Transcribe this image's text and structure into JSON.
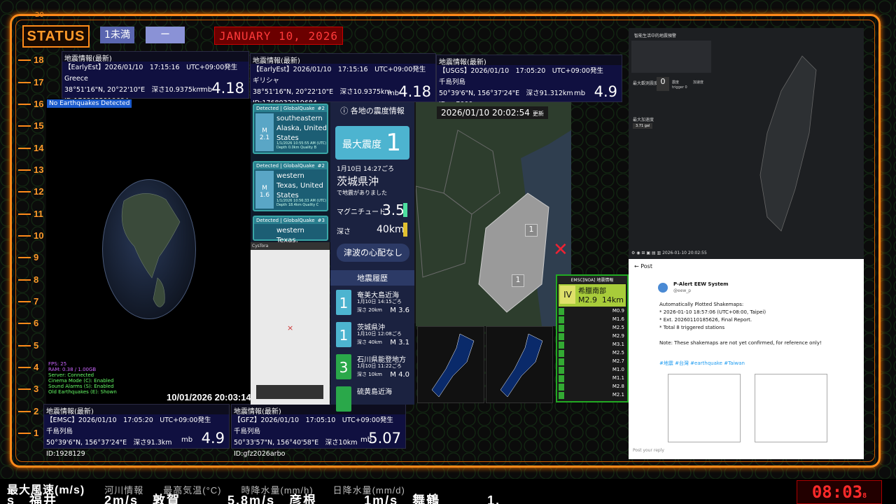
{
  "top_number": "20",
  "status": "STATUS",
  "chip1": "1未満",
  "chip2": "ー",
  "date_banner": "JANUARY 10, 2026",
  "ruler": [
    "18",
    "17",
    "16",
    "15",
    "14",
    "13",
    "12",
    "11",
    "10",
    "9",
    "8",
    "7",
    "6",
    "5",
    "4",
    "3",
    "2",
    "1"
  ],
  "eq_panels": [
    {
      "head": "地震情報(最新)",
      "l1": "【EarlyEst】2026/01/10　17:15:16　UTC+09:00発生",
      "l2": "Greece",
      "l3": "38°51'16\"N, 20°22'10\"E　深さ10.9375km",
      "l4": "ID:1768032919684",
      "mb": "mb",
      "mag": "4.18"
    },
    {
      "head": "地震情報(最新)",
      "l1": "【EarlyEst】2026/01/10　17:15:16　UTC+09:00発生",
      "l2": "ギリシャ",
      "l3": "38°51'16\"N, 20°22'10\"E　深さ10.9375km",
      "l4": "ID:1768032919684",
      "mb": "mb",
      "mag": "4.18"
    },
    {
      "head": "地震情報(最新)",
      "l1": "【USGS】2026/01/10　17:05:20　UTC+09:00発生",
      "l2": "千島列島",
      "l3": "50°39'6\"N, 156°37'24\"E　深さ91.312km",
      "l4": "ID:us7000rnuy",
      "mb": "mb",
      "mag": "4.9"
    },
    {
      "head": "地震情報(最新)",
      "l1": "【EMSC】2026/01/10　17:05:20　UTC+09:00発生",
      "l2": "千島列島",
      "l3": "50°39'6\"N, 156°37'24\"E　深さ91.3km",
      "l4": "ID:1928129",
      "mb": "mb",
      "mag": "4.9"
    },
    {
      "head": "地震情報(最新)",
      "l1": "【GFZ】2026/01/10　17:05:10　UTC+09:00発生",
      "l2": "千島列島",
      "l3": "50°33'57\"N, 156°40'58\"E　深さ10km",
      "l4": "ID:gfz2026arbo",
      "mb": "mb",
      "mag": "5.07"
    }
  ],
  "globe": {
    "tag": "No Earthquakes Detected",
    "info": [
      "FPS: 25",
      "RAM: 0.38 / 1.00GB",
      "Server: Connected",
      "Cinema Mode (C): Enabled",
      "Sound Alarms (S): Enabled",
      "Old Earthquakes (E): Shown"
    ],
    "time": "10/01/2026 20:03:14"
  },
  "quake_cards": [
    {
      "head": "Detected | GlobalQuake",
      "num": "#2",
      "m": "M",
      "mv": "2.1",
      "place": "southeastern Alaska, United States",
      "small": "1/1/2026 10:55:55 AM (UTC) Depth 0.0km Quality B"
    },
    {
      "head": "Detected | GlobalQuake",
      "num": "#2",
      "m": "M",
      "mv": "1.6",
      "place": "western Texas, United States",
      "small": "1/1/2026 10:56:33 AM (UTC) Depth 18.4km Quality C"
    },
    {
      "head": "Detected | GlobalQuake",
      "num": "#3",
      "m": "M",
      "mv": "",
      "place": "western Texas,",
      "small": ""
    }
  ],
  "smallmap_title": "CysTora",
  "shindo": {
    "title": "各地の震度情報",
    "max_label": "最大震度",
    "max_value": "1",
    "time": "1月10日 14:27ごろ",
    "place": "茨城県沖",
    "note": "で地震がありました",
    "mag_label": "マグニチュード",
    "mag_value": "3.5",
    "depth_label": "深さ",
    "depth_value": "40km",
    "tsunami": "津波の心配なし",
    "history_title": "地震履歴",
    "history": [
      {
        "icon": "1",
        "name": "奄美大島近海",
        "time": "1月10日 14:15ごろ",
        "depth": "深さ 20km",
        "mag": "M 3.6",
        "color": "#4db4d0"
      },
      {
        "icon": "1",
        "name": "茨城県沖",
        "time": "1月10日 12:08ごろ",
        "depth": "深さ 40km",
        "mag": "M 3.1",
        "color": "#4db4d0"
      },
      {
        "icon": "3",
        "name": "石川県能登地方",
        "time": "1月10日 11:22ごろ",
        "depth": "深さ 10km",
        "mag": "M 4.0",
        "color": "#2aa84a"
      },
      {
        "icon": "",
        "name": "硫黄島近海",
        "time": "",
        "depth": "",
        "mag": "",
        "color": "#2aa84a"
      }
    ]
  },
  "mainmap": {
    "date": "2026/01/10 20:02:54",
    "update": "更新",
    "marker1": "1",
    "marker2": "1"
  },
  "emsc": {
    "head": "EMSC[NOA] 地震情報",
    "iv": "IV",
    "place": "希臘南部",
    "mag": "M2.9",
    "depth": "14km",
    "rows": [
      {
        "name": "",
        "m": "M0.9"
      },
      {
        "name": "",
        "m": "M1.6"
      },
      {
        "name": "",
        "m": "M2.5"
      },
      {
        "name": "",
        "m": "M2.9"
      },
      {
        "name": "",
        "m": "M3.1"
      },
      {
        "name": "",
        "m": "M2.5"
      },
      {
        "name": "",
        "m": "M2.7"
      },
      {
        "name": "",
        "m": "M1.0"
      },
      {
        "name": "",
        "m": "M1.1"
      },
      {
        "name": "",
        "m": "M2.8"
      },
      {
        "name": "",
        "m": "M2.1"
      }
    ]
  },
  "tw": {
    "title": "智能生活中的地震預警",
    "max_label": "最大觀測震度",
    "max_value": "0",
    "trigger": "trigger",
    "zero": "0",
    "report": "震度",
    "accel": "加速度",
    "max_acc_label": "最大加速度",
    "max_acc": "3.71 gal",
    "footer_time": "2026-01-10 20:02:55"
  },
  "x": {
    "post_label": "Post",
    "author": "P-Alert EEW System",
    "handle": "@eew_p",
    "lines": [
      "Automatically Plotted Shakemaps:",
      "* 2026-01-10 18:57:06 (UTC+08:00, Taipei)",
      "* Ext. 20260110185626, Final Report.",
      "* Total 8 triggered stations",
      "",
      "Note: These shakemaps are not yet confirmed, for reference only!"
    ],
    "tags": "#地震 #台灣 #earthquake #Taiwan",
    "reply": "Post your reply"
  },
  "ticker": {
    "row1": [
      "最大風速(m/s)",
      "河川情報",
      "最高気温(°C)",
      "時降水量(mm/h)",
      "日降水量(mm/d)"
    ],
    "row2": "s　福井 2m/s　敦賀 5.8m/s　彦根 1m/s　舞鶴 1."
  },
  "clock": {
    "time": "08:03",
    "sec": "8"
  }
}
